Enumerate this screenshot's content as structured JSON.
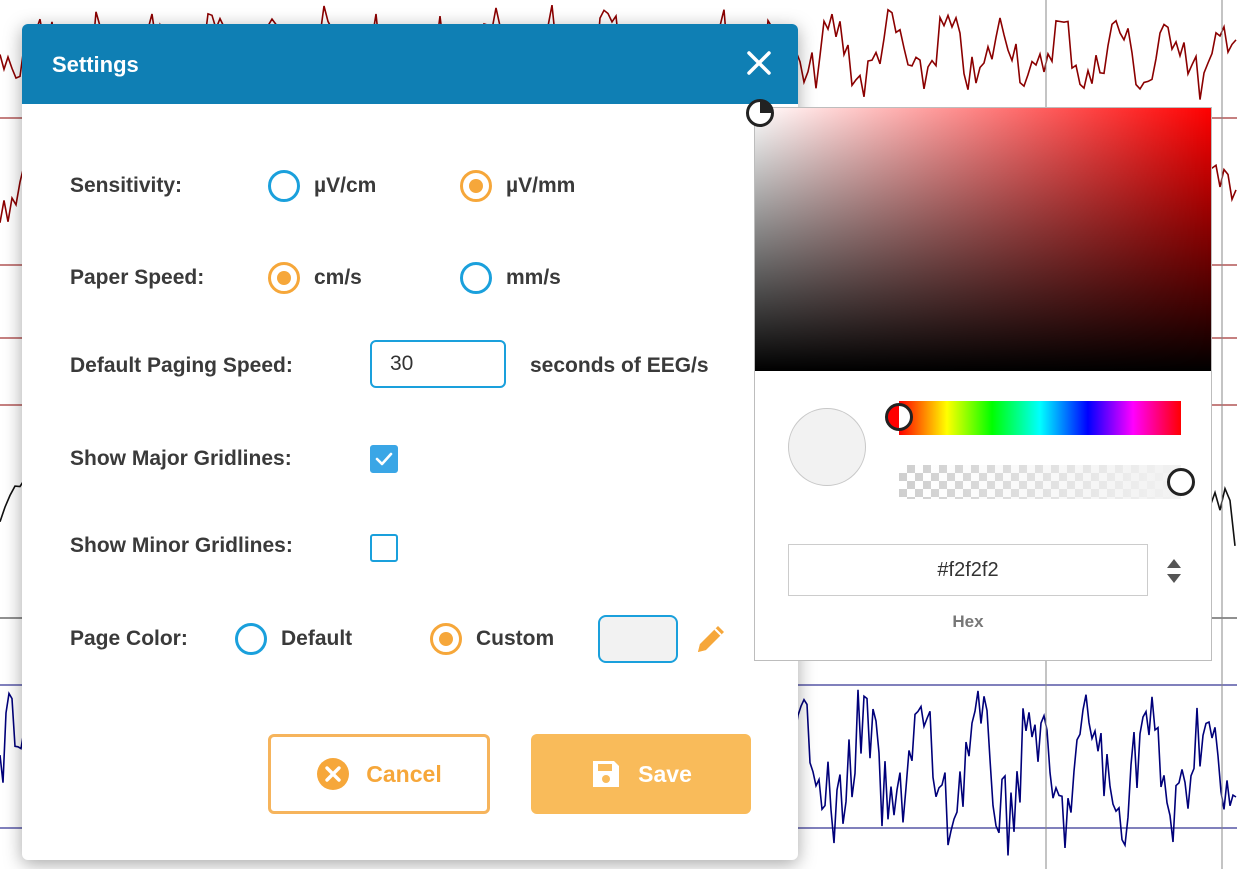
{
  "background": {
    "description_icon": "eeg-waveform",
    "trace_colors": [
      "#8b0000",
      "#111111",
      "#00007a"
    ],
    "gridline_colors": [
      "#8b0000",
      "#222222",
      "#00007a"
    ]
  },
  "dialog": {
    "title": "Settings",
    "header_color": "#0f7fb4",
    "accent_color": "#f6a73a",
    "border_color": "#1aa0dc",
    "sensitivity": {
      "label": "Sensitivity:",
      "options": [
        "µV/cm",
        "µV/mm"
      ],
      "selected": "µV/mm"
    },
    "paper_speed": {
      "label": "Paper Speed:",
      "options": [
        "cm/s",
        "mm/s"
      ],
      "selected": "cm/s"
    },
    "paging_speed": {
      "label": "Default Paging Speed:",
      "value": "30",
      "unit": "seconds of EEG/s"
    },
    "major_gridlines": {
      "label": "Show Major Gridlines:",
      "checked": true
    },
    "minor_gridlines": {
      "label": "Show Minor Gridlines:",
      "checked": false
    },
    "page_color": {
      "label": "Page Color:",
      "options": [
        "Default",
        "Custom"
      ],
      "selected": "Custom",
      "custom_value": "#f2f2f2"
    },
    "buttons": {
      "cancel": "Cancel",
      "save": "Save"
    }
  },
  "color_picker": {
    "hue_color": "#ff0000",
    "hex_value": "#f2f2f2",
    "format_label": "Hex"
  }
}
